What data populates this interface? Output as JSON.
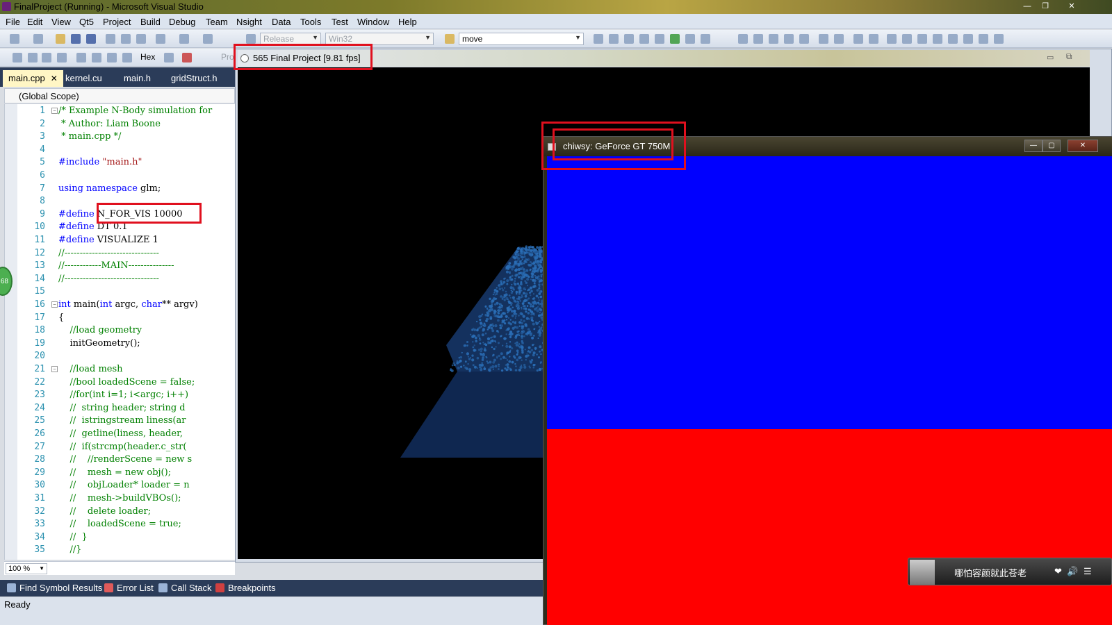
{
  "window": {
    "title": "FinalProject (Running) - Microsoft Visual Studio"
  },
  "menu": [
    "File",
    "Edit",
    "View",
    "Qt5",
    "Project",
    "Build",
    "Debug",
    "Team",
    "Nsight",
    "Data",
    "Tools",
    "Test",
    "Window",
    "Help"
  ],
  "toolbar": {
    "configuration": "Release",
    "platform": "Win32",
    "find": "move",
    "hex_label": "Hex",
    "process_label": "Pro"
  },
  "tabs": [
    {
      "label": "main.cpp",
      "active": true
    },
    {
      "label": "kernel.cu"
    },
    {
      "label": "main.h"
    },
    {
      "label": "gridStruct.h"
    }
  ],
  "scope": "(Global Scope)",
  "code": [
    "/* Example N-Body simulation for",
    " * Author: Liam Boone",
    " * main.cpp */",
    "",
    "#include \"main.h\"",
    "",
    "using namespace glm;",
    "",
    "#define N_FOR_VIS 10000",
    "#define DT 0.1",
    "#define VISUALIZE 1",
    "//-------------------------------",
    "//------------MAIN---------------",
    "//-------------------------------",
    "",
    "int main(int argc, char** argv)",
    "{",
    "    //load geometry",
    "    initGeometry();",
    "",
    "    //load mesh",
    "    //bool loadedScene = false;",
    "    //for(int i=1; i<argc; i++)",
    "    //  string header; string d",
    "    //  istringstream liness(ar",
    "    //  getline(liness, header,",
    "    //  if(strcmp(header.c_str(",
    "    //    //renderScene = new s",
    "    //    mesh = new obj();",
    "    //    objLoader* loader = n",
    "    //    mesh->buildVBOs();",
    "    //    delete loader;",
    "    //    loadedScene = true;",
    "    //  }",
    "    //}"
  ],
  "line_numbers": [
    "1",
    "2",
    "3",
    "4",
    "5",
    "6",
    "7",
    "8",
    "9",
    "10",
    "11",
    "12",
    "13",
    "14",
    "15",
    "16",
    "17",
    "18",
    "19",
    "20",
    "21",
    "22",
    "23",
    "24",
    "25",
    "26",
    "27",
    "28",
    "29",
    "30",
    "31",
    "32",
    "33",
    "34",
    "35"
  ],
  "breakpoint_badge": "68",
  "zoom": "100 %",
  "bottom_tabs": [
    "Find Symbol Results",
    "Error List",
    "Call Stack",
    "Breakpoints"
  ],
  "status": "Ready",
  "project_window": {
    "title": "565 Final Project [9.81 fps]"
  },
  "child_window": {
    "title": "chiwsy: GeForce GT 750M",
    "top_color": "#0000ff",
    "bottom_color": "#ff0000"
  },
  "music": {
    "song": "哪怕容颜就此苍老"
  },
  "colors": {
    "highlight": "#e0101e",
    "particles": "#2a6db5"
  }
}
